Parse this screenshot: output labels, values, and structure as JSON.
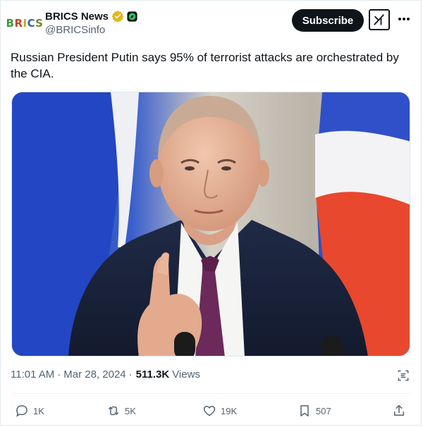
{
  "author": {
    "display_name": "BRICS News",
    "handle": "@BRICSinfo",
    "avatar_text": "BRICS",
    "verified_icon": "verified-badge-icon",
    "affiliation_icon": "affiliate-badge-icon"
  },
  "header": {
    "subscribe_label": "Subscribe",
    "grok_icon": "grok-icon",
    "more_icon": "more-icon"
  },
  "tweet": {
    "text": "Russian President Putin says 95% of terrorist attacks are orchestrated by the CIA.",
    "media_alt": "Photo of Vladimir Putin speaking and pointing his finger in front of Russian flags"
  },
  "meta": {
    "time": "11:01 AM",
    "separator1": "·",
    "date": "Mar 28, 2024",
    "separator2": "·",
    "views_count": "511.3K",
    "views_label": "Views"
  },
  "actions": {
    "replies": "1K",
    "reposts": "5K",
    "likes": "19K",
    "bookmarks": "507"
  },
  "colors": {
    "text": "#0f1419",
    "secondary": "#536471",
    "subscribe_bg": "#0f1419",
    "verified_gold": "#e2b719",
    "affiliate_green": "#00ba7c"
  }
}
